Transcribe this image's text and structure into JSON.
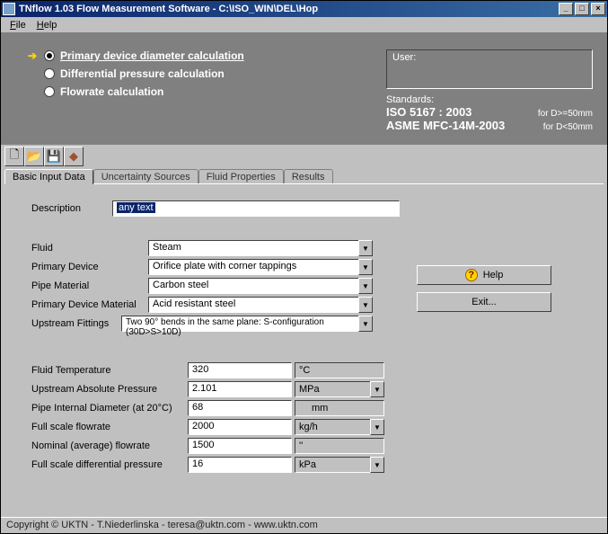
{
  "window": {
    "title": "TNflow 1.03 Flow Measurement Software - C:\\ISO_WIN\\DEL\\Hop"
  },
  "menu": {
    "file": "File",
    "help": "Help"
  },
  "calc": {
    "opt1": "Primary device diameter calculation",
    "opt2": "Differential pressure calculation",
    "opt3": "Flowrate calculation"
  },
  "userbox": {
    "label": "User:"
  },
  "standards": {
    "label": "Standards:",
    "s1": "ISO 5167 : 2003",
    "c1": "for D>=50mm",
    "s2": "ASME  MFC-14M-2003",
    "c2": "for D<50mm"
  },
  "tabs": {
    "t1": "Basic Input Data",
    "t2": "Uncertainty Sources",
    "t3": "Fluid Properties",
    "t4": "Results"
  },
  "form": {
    "description_lbl": "Description",
    "description_val": "any text",
    "fluid_lbl": "Fluid",
    "fluid_val": "Steam",
    "primdev_lbl": "Primary Device",
    "primdev_val": "Orifice plate with corner tappings",
    "pipemat_lbl": "Pipe Material",
    "pipemat_val": "Carbon steel",
    "primdevmat_lbl": "Primary Device Material",
    "primdevmat_val": "Acid resistant steel",
    "upfit_lbl": "Upstream Fittings",
    "upfit_val": "Two 90° bends in the same plane: S-configuration (30D>S>10D)",
    "ftemp_lbl": "Fluid Temperature",
    "ftemp_val": "320",
    "ftemp_unit": "°C",
    "uap_lbl": "Upstream Absolute Pressure",
    "uap_val": "2.101",
    "uap_unit": "MPa",
    "pid_lbl": "Pipe Internal Diameter (at 20°C)",
    "pid_val": "68",
    "pid_unit": "mm",
    "fsf_lbl": "Full scale flowrate",
    "fsf_val": "2000",
    "fsf_unit": "kg/h",
    "nom_lbl": "Nominal (average) flowrate",
    "nom_val": "1500",
    "nom_unit": "''",
    "fsdp_lbl": "Full scale differential pressure",
    "fsdp_val": "16",
    "fsdp_unit": "kPa"
  },
  "buttons": {
    "help": "Help",
    "exit": "Exit..."
  },
  "status": "Copyright © UKTN - T.Niederlinska - teresa@uktn.com - www.uktn.com"
}
